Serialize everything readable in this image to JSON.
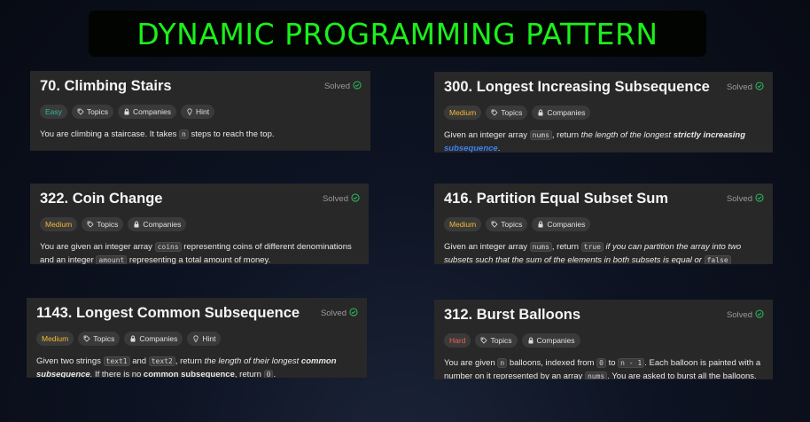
{
  "banner": {
    "title": "DYNAMIC PROGRAMMING PATTERN",
    "color": "#1bf01b"
  },
  "difficulty_colors": {
    "Easy": "#2cbb9d",
    "Medium": "#f5b82e",
    "Hard": "#f0604f"
  },
  "cards": [
    {
      "title": "70. Climbing Stairs",
      "status": "Solved",
      "difficulty": "Easy",
      "tags": [
        {
          "icon": "tag-icon",
          "label": "Topics"
        },
        {
          "icon": "lock-icon",
          "label": "Companies"
        },
        {
          "icon": "lightbulb-icon",
          "label": "Hint"
        }
      ],
      "description": [
        {
          "t": "You are climbing a staircase. It takes ",
          "s": "text"
        },
        {
          "t": "n",
          "s": "code"
        },
        {
          "t": " steps to reach the top.",
          "s": "text"
        }
      ]
    },
    {
      "title": "300. Longest Increasing Subsequence",
      "status": "Solved",
      "difficulty": "Medium",
      "tags": [
        {
          "icon": "tag-icon",
          "label": "Topics"
        },
        {
          "icon": "lock-icon",
          "label": "Companies"
        }
      ],
      "description": [
        {
          "t": "Given an integer array ",
          "s": "text"
        },
        {
          "t": "nums",
          "s": "code"
        },
        {
          "t": ", return ",
          "s": "text"
        },
        {
          "t": "the length of the longest ",
          "s": "i"
        },
        {
          "t": "strictly increasing",
          "s": "bi"
        },
        {
          "t": " ",
          "s": "text"
        },
        {
          "t": "subsequence",
          "s": "link"
        },
        {
          "t": ".",
          "s": "text"
        }
      ]
    },
    {
      "title": "322. Coin Change",
      "status": "Solved",
      "difficulty": "Medium",
      "tags": [
        {
          "icon": "tag-icon",
          "label": "Topics"
        },
        {
          "icon": "lock-icon",
          "label": "Companies"
        }
      ],
      "description": [
        {
          "t": "You are given an integer array ",
          "s": "text"
        },
        {
          "t": "coins",
          "s": "code"
        },
        {
          "t": " representing coins of different denominations and an integer ",
          "s": "text"
        },
        {
          "t": "amount",
          "s": "code"
        },
        {
          "t": " representing a total amount of money.",
          "s": "text"
        }
      ]
    },
    {
      "title": "416. Partition Equal Subset Sum",
      "status": "Solved",
      "difficulty": "Medium",
      "tags": [
        {
          "icon": "tag-icon",
          "label": "Topics"
        },
        {
          "icon": "lock-icon",
          "label": "Companies"
        }
      ],
      "description": [
        {
          "t": "Given an integer array ",
          "s": "text"
        },
        {
          "t": "nums",
          "s": "code"
        },
        {
          "t": ", return ",
          "s": "text"
        },
        {
          "t": "true",
          "s": "code"
        },
        {
          "t": " if you can partition the array into two subsets such that the sum of the elements in both subsets is equal or ",
          "s": "i"
        },
        {
          "t": "false",
          "s": "code"
        }
      ]
    },
    {
      "title": "1143. Longest Common Subsequence",
      "status": "Solved",
      "difficulty": "Medium",
      "tags": [
        {
          "icon": "tag-icon",
          "label": "Topics"
        },
        {
          "icon": "lock-icon",
          "label": "Companies"
        },
        {
          "icon": "lightbulb-icon",
          "label": "Hint"
        }
      ],
      "description": [
        {
          "t": "Given two strings ",
          "s": "text"
        },
        {
          "t": "text1",
          "s": "code"
        },
        {
          "t": " and ",
          "s": "text"
        },
        {
          "t": "text2",
          "s": "code"
        },
        {
          "t": ", return ",
          "s": "text"
        },
        {
          "t": "the length of their longest ",
          "s": "i"
        },
        {
          "t": "common subsequence",
          "s": "bi"
        },
        {
          "t": ".",
          "s": "i"
        },
        {
          "t": " If there is no ",
          "s": "text"
        },
        {
          "t": "common subsequence",
          "s": "b"
        },
        {
          "t": ", return ",
          "s": "text"
        },
        {
          "t": "0",
          "s": "code"
        },
        {
          "t": ".",
          "s": "text"
        }
      ]
    },
    {
      "title": "312. Burst Balloons",
      "status": "Solved",
      "difficulty": "Hard",
      "tags": [
        {
          "icon": "tag-icon",
          "label": "Topics"
        },
        {
          "icon": "lock-icon",
          "label": "Companies"
        }
      ],
      "description": [
        {
          "t": "You are given ",
          "s": "text"
        },
        {
          "t": "n",
          "s": "code"
        },
        {
          "t": " balloons, indexed from ",
          "s": "text"
        },
        {
          "t": "0",
          "s": "code"
        },
        {
          "t": " to ",
          "s": "text"
        },
        {
          "t": "n - 1",
          "s": "code"
        },
        {
          "t": ". Each balloon is painted with a number on it represented by an array ",
          "s": "text"
        },
        {
          "t": "nums",
          "s": "code"
        },
        {
          "t": ". You are asked to burst all the balloons.",
          "s": "text"
        }
      ]
    }
  ]
}
